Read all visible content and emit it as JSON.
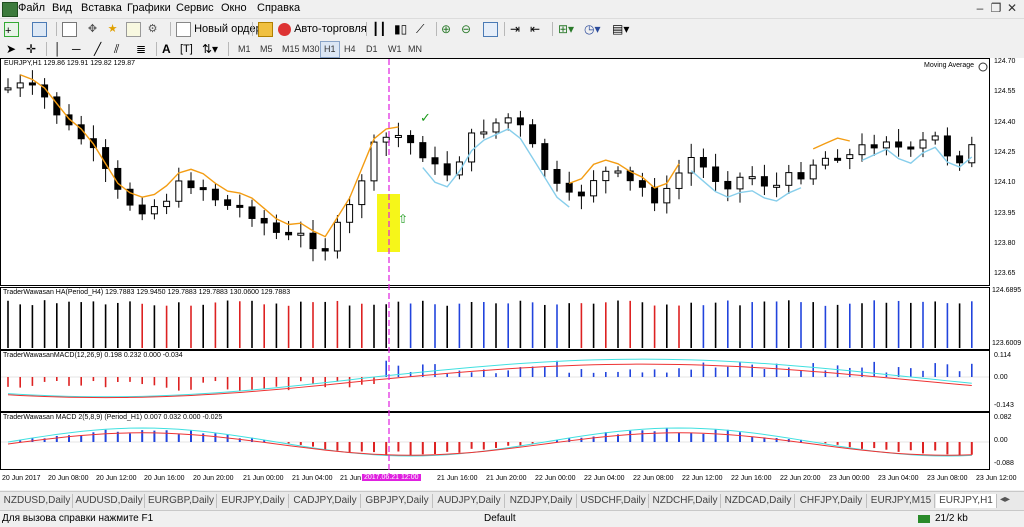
{
  "menu": {
    "items": [
      "Файл",
      "Вид",
      "Вставка",
      "Графики",
      "Сервис",
      "Окно",
      "Справка"
    ]
  },
  "toolbar1": {
    "new_order_label": "Новый ордер",
    "autotrading_label": "Авто-торговля"
  },
  "toolbar2": {
    "timeframes": [
      "M1",
      "M5",
      "M15",
      "M30",
      "H1",
      "H4",
      "D1",
      "W1",
      "MN"
    ],
    "active_timeframe": "H1"
  },
  "chart": {
    "header": "EURJPY,H1  129.86 129.91 129.82 129.87",
    "indicator_name": "Moving Average",
    "price_labels": [
      "124.70",
      "124.55",
      "124.40",
      "124.25",
      "124.10",
      "123.95",
      "123.80",
      "123.65"
    ],
    "sub1": {
      "header": "TraderWawasan HA(Period_H4) 129.7883 129.9450 129.7883 129.7883 130.0600 129.7883",
      "scale_top": "124.6895",
      "scale_bottom": "123.6009"
    },
    "sub2": {
      "header": "TraderWawasanMACD(12,26,9) 0.198 0.232 0.000 -0.034",
      "scale_labels": [
        "0.114",
        "0.00",
        "-0.143"
      ]
    },
    "sub3": {
      "header": "TraderWawasan MACD 2(5,8,9) (Period_H1) 0.007 0.032 0.000 -0.025",
      "scale_labels": [
        "0.082",
        "0.00",
        "-0.088"
      ]
    },
    "time_labels": [
      "20 Jun 2017",
      "20 Jun 08:00",
      "20 Jun 12:00",
      "20 Jun 16:00",
      "20 Jun 20:00",
      "21 Jun 00:00",
      "21 Jun 04:00",
      "21 Jun 08:00",
      "21 Jun 12:00",
      "21 Jun 16:00",
      "21 Jun 20:00",
      "22 Jun 00:00",
      "22 Jun 04:00",
      "22 Jun 08:00",
      "22 Jun 12:00",
      "22 Jun 16:00",
      "22 Jun 20:00",
      "23 Jun 00:00",
      "23 Jun 04:00",
      "23 Jun 08:00",
      "23 Jun 12:00"
    ],
    "cursor_time": "2017.06.21 12:00"
  },
  "tabs": [
    "NZDUSD,Daily",
    "AUDUSD,Daily",
    "EURGBP,Daily",
    "EURJPY,Daily",
    "CADJPY,Daily",
    "GBPJPY,Daily",
    "AUDJPY,Daily",
    "NZDJPY,Daily",
    "USDCHF,Daily",
    "NZDCHF,Daily",
    "NZDCAD,Daily",
    "CHFJPY,Daily",
    "EURJPY,M15",
    "EURJPY,H1"
  ],
  "status": {
    "help": "Для вызова справки нажмите F1",
    "profile": "Default",
    "traffic": "21/2 kb"
  },
  "colors": {
    "ma_orange": "#f39c12",
    "ma_blue": "#87ceeb",
    "cursor_magenta": "#e020e0",
    "highlight_yellow": "#f5f500",
    "bull_blue": "#2244dd",
    "bear_red": "#dd2222"
  }
}
